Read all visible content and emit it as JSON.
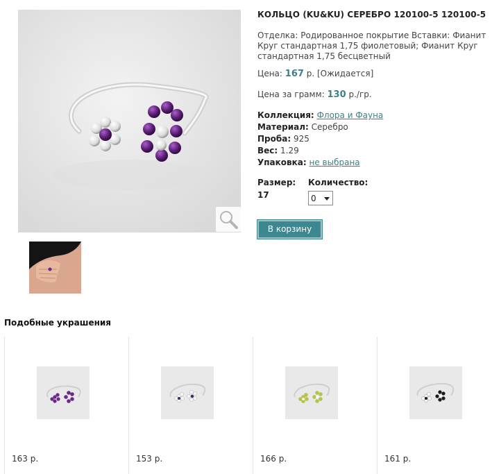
{
  "product": {
    "title": "КОЛЬЦО (KU&KU) СЕРЕБРО 120100-5 120100-5",
    "description": "Отделка: Родированное покрытие Вставки: Фианит Круг стандартная 1,75 фиолетовый; Фианит Круг стандартная 1,75 бесцветный",
    "price_label": "Цена:",
    "price_value": "167",
    "price_suffix": "р. [Ожидается]",
    "gram_label": "Цена за грамм:",
    "gram_value": "130",
    "gram_suffix": "р./гр.",
    "collection_label": "Коллекция:",
    "collection_value": "Флора и Фауна",
    "material_label": "Материал:",
    "material_value": "Серебро",
    "proba_label": "Проба:",
    "proba_value": "925",
    "weight_label": "Вес:",
    "weight_value": "1.29",
    "packaging_label": "Упаковка:",
    "packaging_value": "не выбрана",
    "size_label": "Размер:",
    "size_value": "17",
    "qty_label": "Количество:",
    "qty_value": "0",
    "cart_button": "В корзину"
  },
  "similar": {
    "title": "Подобные украшения",
    "items": [
      {
        "price": "163 р.",
        "stone_color": "#6a2a86"
      },
      {
        "price": "153 р.",
        "stone_color": "#2a2f6a"
      },
      {
        "price": "166 р.",
        "stone_color": "#b7c24a"
      },
      {
        "price": "161 р.",
        "stone_color": "#1c1c1c"
      }
    ]
  },
  "colors": {
    "accent": "#3c8089",
    "button_bg": "#3d8790",
    "amethyst": "#5e1f78",
    "image_bg": "#e9e9e9"
  },
  "icons": {
    "zoom": "magnifier-icon",
    "select": "chevron-down-icon"
  }
}
